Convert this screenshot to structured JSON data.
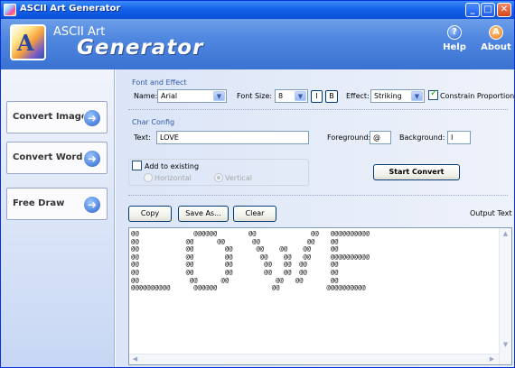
{
  "window": {
    "title": "ASCII Art Generator",
    "controls": {
      "minimize": "_",
      "maximize": "□",
      "close": "✕"
    }
  },
  "banner": {
    "brand_small": "ASCII Art",
    "brand_big": "Generator",
    "help_label": "Help",
    "help_icon": "?",
    "about_label": "About",
    "about_icon": "A"
  },
  "nav": [
    {
      "label": "Convert Image",
      "icon": "arrow-right"
    },
    {
      "label": "Convert Word",
      "icon": "arrow-right"
    },
    {
      "label": "Free Draw",
      "icon": "arrow-right"
    }
  ],
  "font_effect": {
    "title": "Font and Effect",
    "name_label": "Name:",
    "name_value": "Arial",
    "font_size_label": "Font Size:",
    "font_size_value": "8",
    "italic_label": "I",
    "bold_label": "B",
    "effect_label": "Effect:",
    "effect_value": "Striking",
    "constrain_label": "Constrain Proportion",
    "constrain_checked": true
  },
  "char_config": {
    "title": "Char Config",
    "text_label": "Text:",
    "text_value": "LOVE",
    "foreground_label": "Foreground:",
    "foreground_value": "@",
    "background_label": "Background:",
    "background_value": "I"
  },
  "add_existing": {
    "label": "Add to existing",
    "checked": false,
    "horizontal_label": "Horizontal",
    "vertical_label": "Vertical",
    "selected": "Vertical"
  },
  "actions": {
    "start_convert": "Start Convert",
    "copy": "Copy",
    "save_as": "Save As...",
    "clear": "Clear",
    "output_text_label": "Output Text"
  },
  "output_text": "@@              @@@@@@        @@              @@   @@@@@@@@@@\n@@            @@      @@       @@            @@    @@\n@@            @@        @@      @@    @@    @@     @@\n@@            @@        @@       @@    @@   @@     @@@@@@@@@@\n@@            @@        @@        @@   @@  @@      @@\n@@            @@        @@        @@   @@  @@      @@\n@@             @@      @@            @@   @@       @@\n@@@@@@@@@@      @@@@@@              @@            @@@@@@@@@@",
  "colors": {
    "titlebar": "#0a4fd8",
    "banner": "#4f86df",
    "accent": "#2f5aa8"
  }
}
